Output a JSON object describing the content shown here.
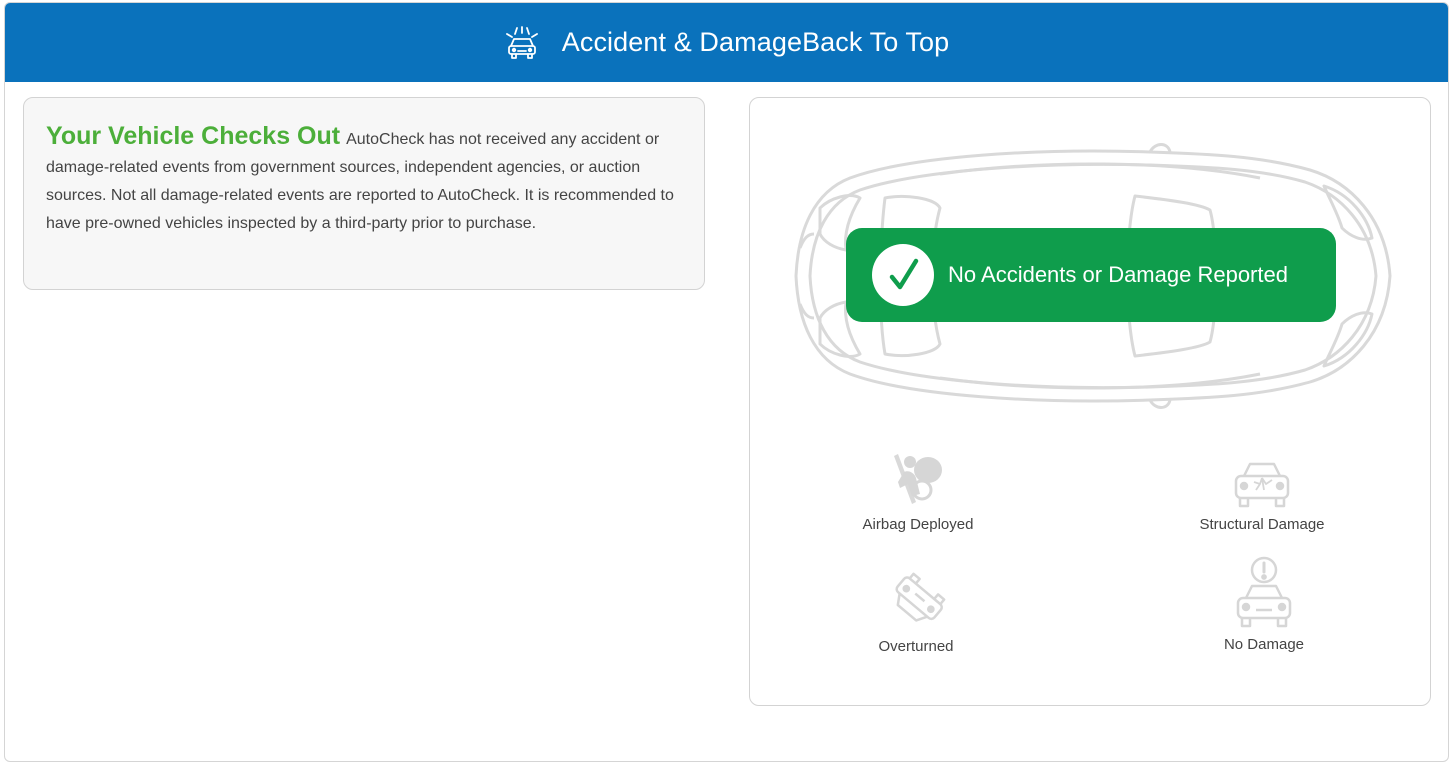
{
  "header": {
    "title": "Accident & Damage",
    "back_link": "Back To Top",
    "icon": "car-crash-icon"
  },
  "summary": {
    "headline": "Your Vehicle Checks Out",
    "body": "AutoCheck has not received any accident or damage-related events from government sources, independent agencies, or auction sources. Not all damage-related events are reported to AutoCheck. It is recommended to have pre-owned vehicles inspected by a third-party prior to purchase."
  },
  "status": {
    "label": "No Accidents or Damage Reported",
    "icon": "checkmark-icon",
    "color": "#0f9d4c"
  },
  "indicators": [
    {
      "label": "Airbag Deployed",
      "icon": "airbag-icon"
    },
    {
      "label": "Structural Damage",
      "icon": "cracked-windshield-car-icon"
    },
    {
      "label": "Overturned",
      "icon": "overturned-car-icon"
    },
    {
      "label": "No Damage",
      "icon": "car-alert-icon"
    }
  ],
  "colors": {
    "header_bg": "#0a72bc",
    "headline": "#4caf3a",
    "status_bg": "#0f9d4c"
  }
}
